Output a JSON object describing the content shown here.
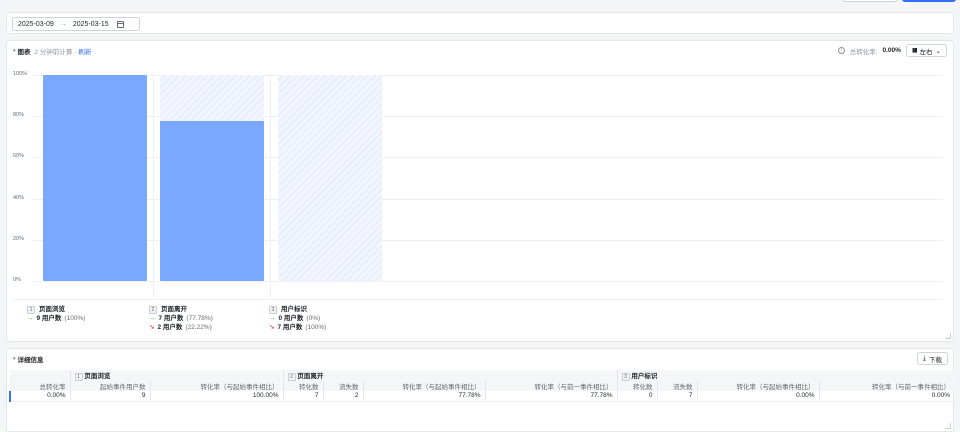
{
  "date_filter": {
    "start": "2025-03-09",
    "arrow": "→",
    "end": "2025-03-15"
  },
  "chart_panel": {
    "title": "图表",
    "subtitle": "2 分钟前计算 ·",
    "refresh": "刷新",
    "total_rate_label": "总转化率:",
    "total_rate_value": "0.00%",
    "layout_label": "左右"
  },
  "chart_data": {
    "type": "bar",
    "categories": [
      "页面浏览",
      "页面离开",
      "用户标识"
    ],
    "values": [
      100,
      77.78,
      0
    ],
    "yticks": [
      "100%",
      "80%",
      "60%",
      "40%",
      "20%",
      "0%"
    ],
    "ylim": [
      0,
      100
    ],
    "color": "#7aa7ff",
    "grid": true
  },
  "legend": [
    {
      "step": "1",
      "title": "页面浏览",
      "rows": [
        {
          "dir": "→",
          "kind": "green",
          "strong": "9 用户数",
          "pct": "(100%)"
        }
      ]
    },
    {
      "step": "2",
      "title": "页面离开",
      "rows": [
        {
          "dir": "→",
          "kind": "green",
          "strong": "7 用户数",
          "pct": "(77.78%)"
        },
        {
          "dir": "↘",
          "kind": "red",
          "strong": "2 用户数",
          "pct": "(22.22%)"
        }
      ]
    },
    {
      "step": "3",
      "title": "用户标识",
      "rows": [
        {
          "dir": "→",
          "kind": "green",
          "strong": "0 用户数",
          "pct": "(0%)"
        },
        {
          "dir": "↘",
          "kind": "red",
          "strong": "7 用户数",
          "pct": "(100%)"
        }
      ]
    }
  ],
  "detail_panel": {
    "title": "详细信息",
    "download": "下载",
    "groups": [
      {
        "step": "1",
        "title": "页面浏览"
      },
      {
        "step": "2",
        "title": "页面离开"
      },
      {
        "step": "3",
        "title": "用户标识"
      }
    ],
    "headers": [
      "总转化率",
      "起始事件用户数",
      "转化率（与起始事件相比）",
      "转化数",
      "流失数",
      "转化率（与起始事件相比）",
      "转化率（与前一事件相比）",
      "转化数",
      "流失数",
      "转化率（与起始事件相比）",
      "转化率（与前一事件相比）"
    ],
    "row": [
      "0.00%",
      "9",
      "100.00%",
      "7",
      "2",
      "77.78%",
      "77.78%",
      "0",
      "7",
      "0.00%",
      "0.00%"
    ]
  },
  "colors": {
    "accent": "#3370ff",
    "bar": "#7aa7ff",
    "up": "#34c724",
    "down": "#f54a45"
  }
}
